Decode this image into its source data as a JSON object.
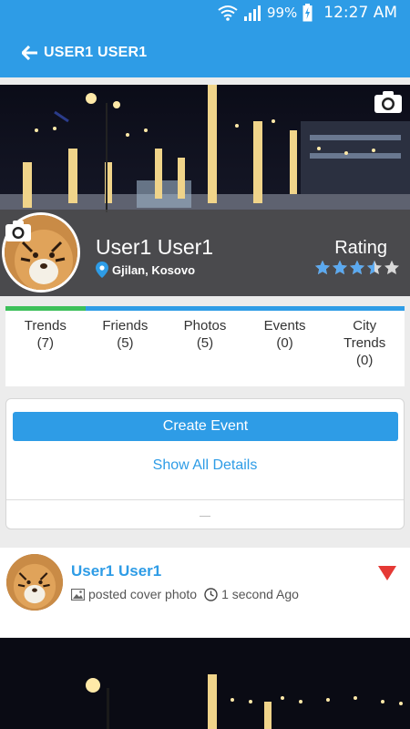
{
  "status_bar": {
    "battery": "99%",
    "time": "12:27 AM",
    "icons": [
      "wifi-icon",
      "signal-icon",
      "battery-icon"
    ]
  },
  "app_bar": {
    "title": "USER1 USER1",
    "back_icon": "arrow-left-icon"
  },
  "profile": {
    "name": "User1 User1",
    "location": "Gjilan, Kosovo",
    "rating_label": "Rating",
    "rating_stars": 3.5,
    "rating_max": 5,
    "star_color": "#5aa9f0"
  },
  "stats": [
    {
      "label": "Trends",
      "value": "(7)"
    },
    {
      "label": "Friends",
      "value": "(5)"
    },
    {
      "label": "Photos",
      "value": "(5)"
    },
    {
      "label": "Events",
      "value": "(0)"
    },
    {
      "label": "City Trends",
      "label_line1": "City",
      "label_line2": "Trends",
      "value": "(0)"
    }
  ],
  "events": {
    "create_label": "Create Event",
    "details_label": "Show All Details"
  },
  "post": {
    "author": "User1 User1",
    "action": "posted cover photo",
    "time": "1 second Ago"
  },
  "colors": {
    "primary": "#2e9ce6",
    "accent_green": "#3cc05a",
    "menu_red": "#e53935"
  }
}
